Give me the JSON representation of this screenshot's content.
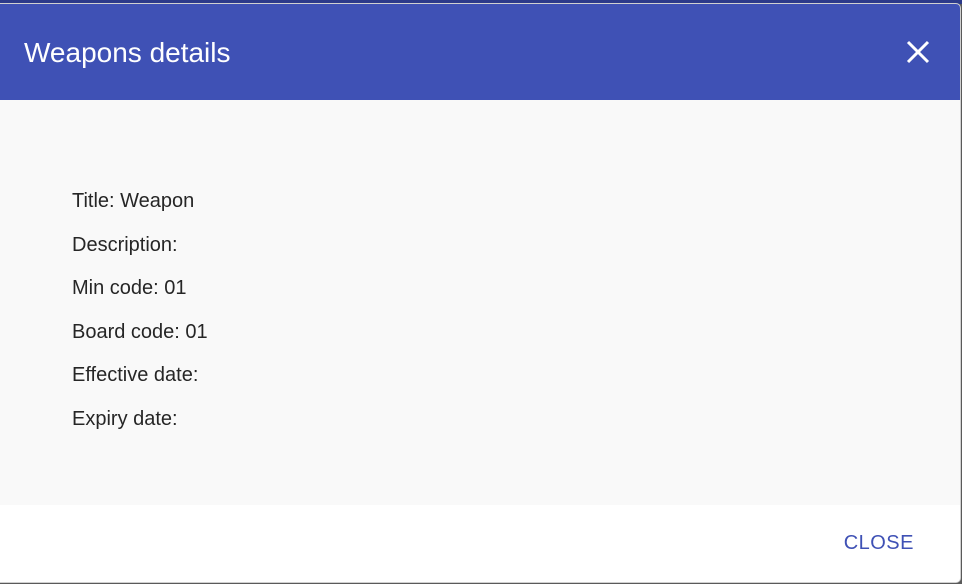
{
  "dialog": {
    "title": "Weapons details",
    "close_icon": "close-icon",
    "details": [
      {
        "text": "Title: Weapon"
      },
      {
        "text": "Description:"
      },
      {
        "text": "Min code: 01"
      },
      {
        "text": "Board code: 01"
      },
      {
        "text": "Effective date:"
      },
      {
        "text": "Expiry date:"
      }
    ],
    "close_label": "CLOSE"
  },
  "colors": {
    "header": "#3f51b5",
    "body_bg": "#f9f9f9",
    "accent": "#3f51b5"
  }
}
